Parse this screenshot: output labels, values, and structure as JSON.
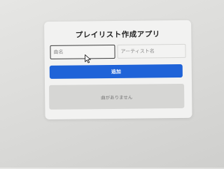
{
  "app": {
    "title": "プレイリスト作成アプリ"
  },
  "form": {
    "song_name_placeholder": "曲名",
    "song_name_value": "",
    "artist_name_placeholder": "アーティスト名",
    "artist_name_value": "",
    "add_button_label": "追加"
  },
  "playlist": {
    "empty_message": "曲がありません"
  },
  "colors": {
    "accent": "#1f63d8",
    "card_background": "#f2f2f1",
    "empty_state_background": "#d6d6d4"
  },
  "icons": {
    "cursor": "mouse-pointer-icon"
  }
}
